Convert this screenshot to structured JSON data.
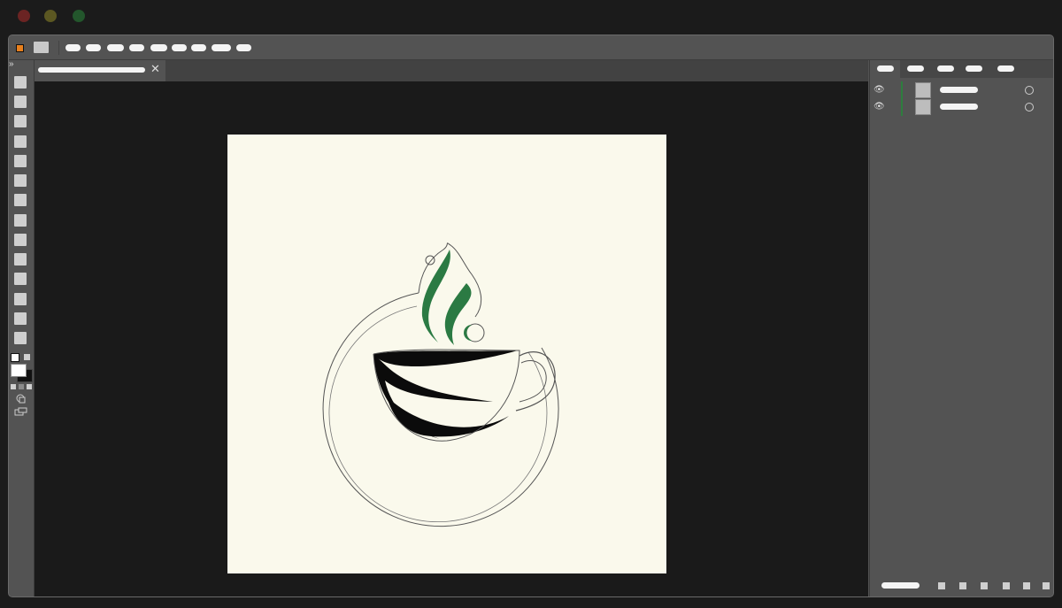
{
  "window": {
    "traffic_lights": [
      {
        "name": "close",
        "color": "#6b2423"
      },
      {
        "name": "minimize",
        "color": "#5b5722"
      },
      {
        "name": "zoom",
        "color": "#23562c"
      }
    ]
  },
  "app": {
    "icon": "app-logo-icon",
    "menu_items_count": 9
  },
  "document": {
    "tab_close_glyph": "✕"
  },
  "artwork": {
    "colors": {
      "paper": "#faf9ec",
      "ink": "#0b0b0b",
      "steam_green": "#2b7a43",
      "outline": "#555555"
    },
    "icons": [
      "coffee-cup-logo",
      "steam-swirl",
      "saucer-ring"
    ]
  },
  "layers_panel": {
    "layers": [
      {
        "visible": true,
        "color": "#2e7d3e"
      },
      {
        "visible": true,
        "color": "#2e7d3e"
      }
    ]
  },
  "theme": {
    "chrome_bg": "#535353",
    "canvas_bg": "#1a1a1a",
    "tool_icon": "#cfcfcf"
  }
}
